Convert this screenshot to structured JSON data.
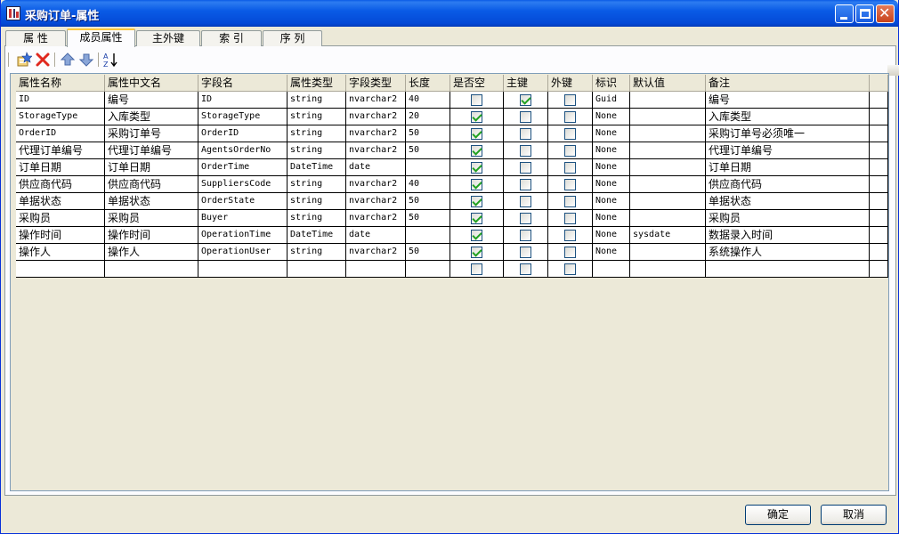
{
  "window": {
    "title": "采购订单-属性"
  },
  "tabs": [
    {
      "label": "属 性"
    },
    {
      "label": "成员属性"
    },
    {
      "label": "主外键"
    },
    {
      "label": "索 引"
    },
    {
      "label": "序 列"
    }
  ],
  "toolbar": {
    "icons": [
      "add-properties-icon",
      "delete-icon",
      "move-up-icon",
      "move-down-icon",
      "sort-az-icon"
    ]
  },
  "grid": {
    "columns": [
      "属性名称",
      "属性中文名",
      "字段名",
      "属性类型",
      "字段类型",
      "长度",
      "是否空",
      "主键",
      "外键",
      "标识",
      "默认值",
      "备注"
    ],
    "rows": [
      {
        "name": "ID",
        "cn": "编号",
        "field": "ID",
        "ptype": "string",
        "ftype": "nvarchar2",
        "len": "40",
        "nullable": false,
        "pk": true,
        "fk": false,
        "ident": "Guid",
        "def": "",
        "remark": "编号"
      },
      {
        "name": "StorageType",
        "cn": "入库类型",
        "field": "StorageType",
        "ptype": "string",
        "ftype": "nvarchar2",
        "len": "20",
        "nullable": true,
        "pk": false,
        "fk": false,
        "ident": "None",
        "def": "",
        "remark": "入库类型"
      },
      {
        "name": "OrderID",
        "cn": "采购订单号",
        "field": "OrderID",
        "ptype": "string",
        "ftype": "nvarchar2",
        "len": "50",
        "nullable": true,
        "pk": false,
        "fk": false,
        "ident": "None",
        "def": "",
        "remark": "采购订单号必须唯一"
      },
      {
        "name": "代理订单编号",
        "cn": "代理订单编号",
        "field": "AgentsOrderNo",
        "ptype": "string",
        "ftype": "nvarchar2",
        "len": "50",
        "nullable": true,
        "pk": false,
        "fk": false,
        "ident": "None",
        "def": "",
        "remark": "代理订单编号"
      },
      {
        "name": "订单日期",
        "cn": "订单日期",
        "field": "OrderTime",
        "ptype": "DateTime",
        "ftype": "date",
        "len": "",
        "nullable": true,
        "pk": false,
        "fk": false,
        "ident": "None",
        "def": "",
        "remark": "订单日期"
      },
      {
        "name": "供应商代码",
        "cn": "供应商代码",
        "field": "SuppliersCode",
        "ptype": "string",
        "ftype": "nvarchar2",
        "len": "40",
        "nullable": true,
        "pk": false,
        "fk": false,
        "ident": "None",
        "def": "",
        "remark": "供应商代码"
      },
      {
        "name": "单据状态",
        "cn": "单据状态",
        "field": "OrderState",
        "ptype": "string",
        "ftype": "nvarchar2",
        "len": "50",
        "nullable": true,
        "pk": false,
        "fk": false,
        "ident": "None",
        "def": "",
        "remark": "单据状态"
      },
      {
        "name": "采购员",
        "cn": "采购员",
        "field": "Buyer",
        "ptype": "string",
        "ftype": "nvarchar2",
        "len": "50",
        "nullable": true,
        "pk": false,
        "fk": false,
        "ident": "None",
        "def": "",
        "remark": "采购员"
      },
      {
        "name": "操作时间",
        "cn": "操作时间",
        "field": "OperationTime",
        "ptype": "DateTime",
        "ftype": "date",
        "len": "",
        "nullable": true,
        "pk": false,
        "fk": false,
        "ident": "None",
        "def": "sysdate",
        "remark": "数据录入时间"
      },
      {
        "name": "操作人",
        "cn": "操作人",
        "field": "OperationUser",
        "ptype": "string",
        "ftype": "nvarchar2",
        "len": "50",
        "nullable": true,
        "pk": false,
        "fk": false,
        "ident": "None",
        "def": "",
        "remark": "系统操作人"
      },
      {
        "name": "",
        "cn": "",
        "field": "",
        "ptype": "",
        "ftype": "",
        "len": "",
        "nullable": false,
        "pk": false,
        "fk": false,
        "ident": "",
        "def": "",
        "remark": ""
      }
    ]
  },
  "buttons": {
    "ok": "确定",
    "cancel": "取消"
  }
}
